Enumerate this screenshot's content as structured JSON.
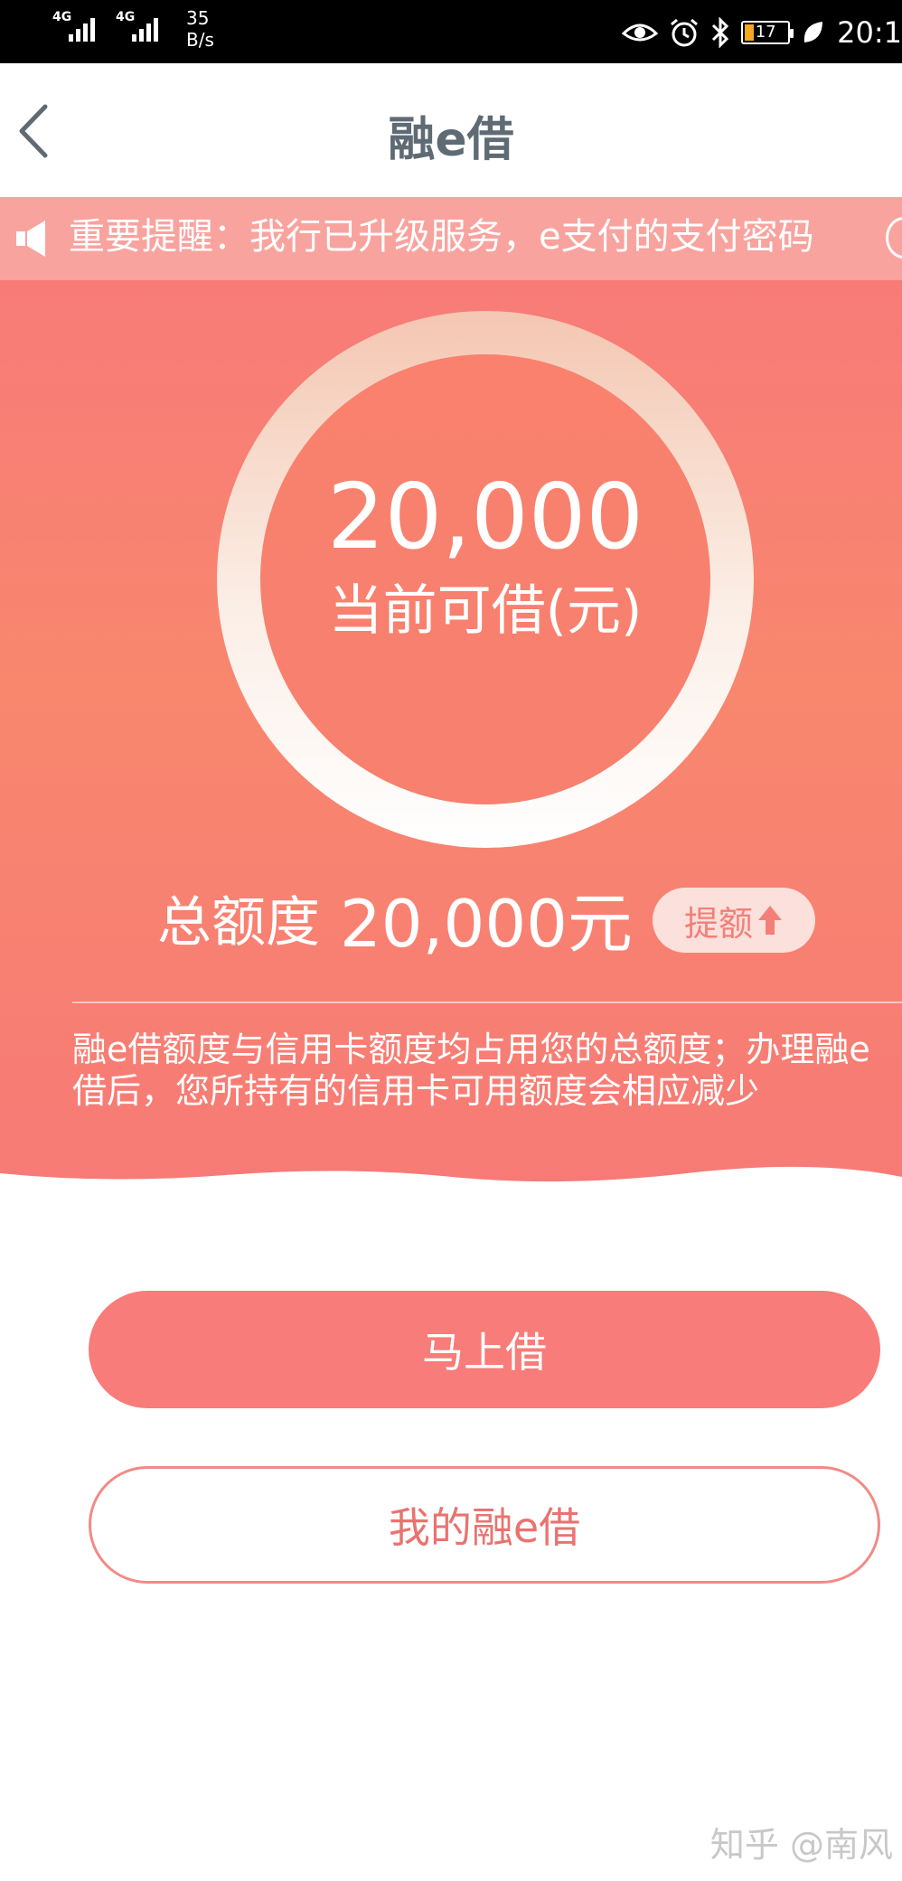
{
  "status_bar": {
    "network_1": "4G",
    "network_2": "4G",
    "speed_value": "35",
    "speed_unit": "B/s",
    "battery": "17",
    "time": "20:1"
  },
  "nav": {
    "title": "融e借"
  },
  "notice": {
    "text": "重要提醒：我行已升级服务，e支付的支付密码"
  },
  "hero": {
    "available_amount": "20,000",
    "available_label": "当前可借(元)",
    "total_label": "总额度",
    "total_value": "20,000元",
    "raise_label": "提额",
    "description": "融e借额度与信用卡额度均占用您的总额度；办理融e借后，您所持有的信用卡可用额度会相应减少"
  },
  "actions": {
    "borrow_now": "马上借",
    "my_loan": "我的融e借"
  },
  "watermark": "知乎 @南风",
  "colors": {
    "accent": "#f87c79",
    "notice_bg": "#f9a39f",
    "title_gray": "#5f6b74"
  }
}
